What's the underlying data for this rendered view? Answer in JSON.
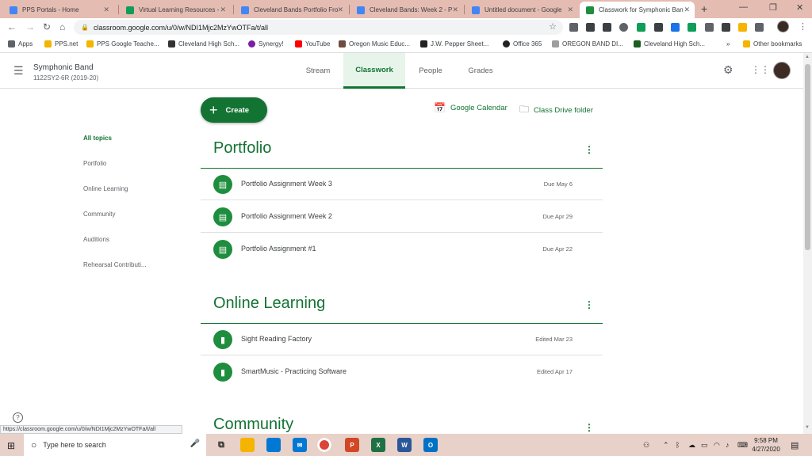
{
  "browser": {
    "tabs": [
      {
        "title": "PPS Portals - Home",
        "icon_color": "#4285f4",
        "active": false
      },
      {
        "title": "Virtual Learning Resources -",
        "icon_color": "#0f9d58",
        "active": false
      },
      {
        "title": "Cleveland Bands Portfolio Fro",
        "icon_color": "#4285f4",
        "active": false
      },
      {
        "title": "Cleveland Bands: Week 2 - P",
        "icon_color": "#4285f4",
        "active": false
      },
      {
        "title": "Untitled document - Google",
        "icon_color": "#4285f4",
        "active": false
      },
      {
        "title": "Classwork for Symphonic Ban",
        "icon_color": "#1e8e3e",
        "active": true
      }
    ],
    "url": "classroom.google.com/u/0/w/NDI1Mjc2MzYwOTFa/t/all",
    "bookmarks": [
      {
        "label": "Apps",
        "color": "#5f6368"
      },
      {
        "label": "PPS.net",
        "color": "#f4b400"
      },
      {
        "label": "PPS Google Teache...",
        "color": "#f4b400"
      },
      {
        "label": "Cleveland High Sch...",
        "color": "#333333"
      },
      {
        "label": "Synergy!",
        "color": "#7b1fa2"
      },
      {
        "label": "YouTube",
        "color": "#ff0000"
      },
      {
        "label": "Oregon Music Educ...",
        "color": "#6d4c41"
      },
      {
        "label": "J.W. Pepper Sheet...",
        "color": "#222222"
      },
      {
        "label": "Office 365",
        "color": "#222222"
      },
      {
        "label": "OREGON BAND DI...",
        "color": "#9e9e9e"
      },
      {
        "label": "Cleveland High Sch...",
        "color": "#1b5e20"
      }
    ],
    "bookmarks_more": "»",
    "other_bookmarks": "Other bookmarks",
    "status_url": "https://classroom.google.com/u/0/w/NDI1Mjc2MzYwOTFa/t/all"
  },
  "classroom": {
    "class_name": "Symphonic Band",
    "class_section": "1122SY2-6R (2019-20)",
    "tabs": [
      {
        "label": "Stream",
        "active": false
      },
      {
        "label": "Classwork",
        "active": true
      },
      {
        "label": "People",
        "active": false
      },
      {
        "label": "Grades",
        "active": false
      }
    ],
    "create_label": "Create",
    "calendar_label": "Google Calendar",
    "drive_label": "Class Drive folder",
    "topics": [
      "All topics",
      "Portfolio",
      "Online Learning",
      "Community",
      "Auditions",
      "Rehearsal Contributi..."
    ],
    "sections": [
      {
        "title": "Portfolio",
        "items": [
          {
            "title": "Portfolio Assignment Week 3",
            "meta": "Due May 6",
            "icon": "assignment-icon"
          },
          {
            "title": "Portfolio Assignment Week 2",
            "meta": "Due Apr 29",
            "icon": "assignment-icon"
          },
          {
            "title": "Portfolio Assignment #1",
            "meta": "Due Apr 22",
            "icon": "assignment-icon"
          }
        ]
      },
      {
        "title": "Online Learning",
        "items": [
          {
            "title": "Sight Reading Factory",
            "meta": "Edited Mar 23",
            "icon": "material-icon"
          },
          {
            "title": "SmartMusic - Practicing Software",
            "meta": "Edited Apr 17",
            "icon": "material-icon"
          }
        ]
      }
    ],
    "partial_section_title": "Community"
  },
  "taskbar": {
    "search_placeholder": "Type here to search",
    "time": "9:58 PM",
    "date": "4/27/2020"
  },
  "colors": {
    "accent": "#137333",
    "tabstrip": "#e5bcb2",
    "taskbar": "#e8d1c9"
  }
}
